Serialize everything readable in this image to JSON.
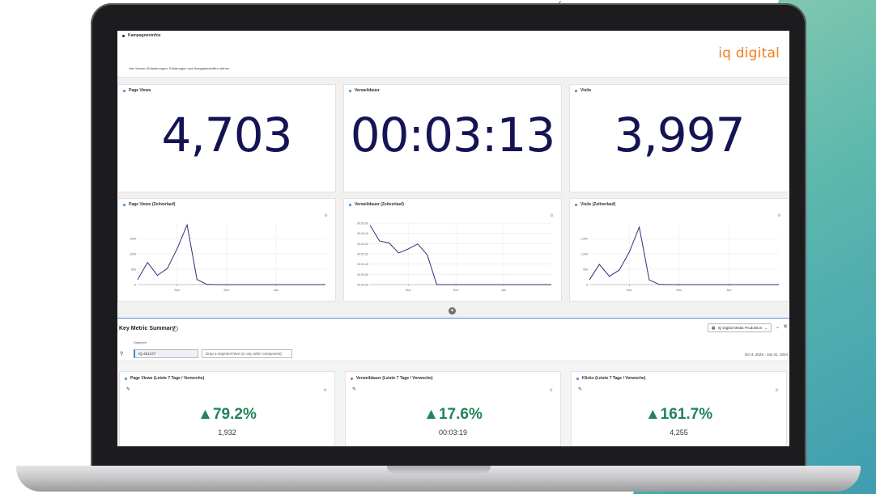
{
  "header": {
    "section_title": "Kampagneninfos",
    "description": "Hier können Erläuterungen, Erklärungen und Navigationshilfen stehen.",
    "logo_text": "iq digital"
  },
  "kpis": [
    {
      "title": "Page Views",
      "value": "4,703"
    },
    {
      "title": "Verweildauer",
      "value": "00:03:13"
    },
    {
      "title": "Visits",
      "value": "3,997"
    }
  ],
  "trend_charts": [
    {
      "title": "Page Views (Zeitverlauf)",
      "yticks": [
        "0",
        "500",
        "1000",
        "1500"
      ]
    },
    {
      "title": "Verweildauer (Zeitverlauf)",
      "yticks": [
        "00:00:00",
        "00:00:50",
        "00:01:40",
        "00:02:30",
        "00:03:20",
        "00:04:10",
        "00:05:00"
      ]
    },
    {
      "title": "Visits (Zeitverlauf)",
      "yticks": [
        "0",
        "500",
        "1,000",
        "1,500"
      ]
    }
  ],
  "chart_data": [
    {
      "type": "line",
      "title": "Page Views (Zeitverlauf)",
      "x": [
        "",
        "",
        "",
        "",
        "Nov",
        "",
        "",
        "",
        "",
        "Dec",
        "",
        "",
        "",
        "",
        "Jan",
        "",
        "",
        "",
        "",
        ""
      ],
      "xticks": [
        "Nov",
        "Dec",
        "Jan"
      ],
      "yticks": [
        "0",
        "500",
        "1000",
        "1500"
      ],
      "series": [
        {
          "values": [
            150,
            650,
            270,
            470,
            1050,
            1750,
            150,
            5,
            0,
            0,
            0,
            0,
            0,
            0,
            0,
            0,
            0,
            0,
            0,
            0
          ]
        }
      ],
      "ylim": [
        0,
        1800
      ]
    },
    {
      "type": "line",
      "title": "Verweildauer (Zeitverlauf)",
      "xticks": [
        "Nov",
        "Dec",
        "Jan"
      ],
      "yticks": [
        "00:00:00",
        "00:00:50",
        "00:01:40",
        "00:02:30",
        "00:03:20",
        "00:04:10",
        "00:05:00"
      ],
      "series": [
        {
          "values": [
            300,
            220,
            210,
            160,
            180,
            205,
            150,
            0,
            0,
            0,
            0,
            0,
            0,
            0,
            0,
            0,
            0,
            0,
            0,
            0
          ]
        }
      ],
      "ylim": [
        0,
        310
      ]
    },
    {
      "type": "line",
      "title": "Visits (Zeitverlauf)",
      "xticks": [
        "Nov",
        "Dec",
        "Jan"
      ],
      "yticks": [
        "0",
        "500",
        "1,000",
        "1,500"
      ],
      "series": [
        {
          "values": [
            130,
            560,
            230,
            400,
            900,
            1590,
            130,
            5,
            0,
            0,
            0,
            0,
            0,
            0,
            0,
            0,
            0,
            0,
            0,
            0
          ]
        }
      ],
      "ylim": [
        0,
        1700
      ]
    }
  ],
  "summary": {
    "title": "Key Metric Summary",
    "report_suite": "IQ Digital Media Produktion",
    "segment_label": "Segment",
    "segment_value": "IQ-401377",
    "segment_drop_placeholder": "Drop a segment here (or any other component)",
    "date_range": "Oct 4, 2023 - Jan 31, 2024",
    "cards": [
      {
        "title": "Page Views (Letzte 7 Tage / Vorwoche)",
        "change": "▲79.2%",
        "value": "1,932",
        "dot_color": "#3a8fd6"
      },
      {
        "title": "Verweildauer (Letzte 7 Tage / Vorwoche)",
        "change": "▲17.6%",
        "value": "00:03:19",
        "dot_color": "#e05a3a"
      },
      {
        "title": "Klicks (Letzte 7 Tage / Vorwoche)",
        "change": "▲161.7%",
        "value": "4,255",
        "dot_color": "#7a6fd6"
      }
    ]
  },
  "colors": {
    "accent": "#141455",
    "positive": "#21845a",
    "logo": "#f27f1b",
    "line": "#2e2c7a"
  }
}
